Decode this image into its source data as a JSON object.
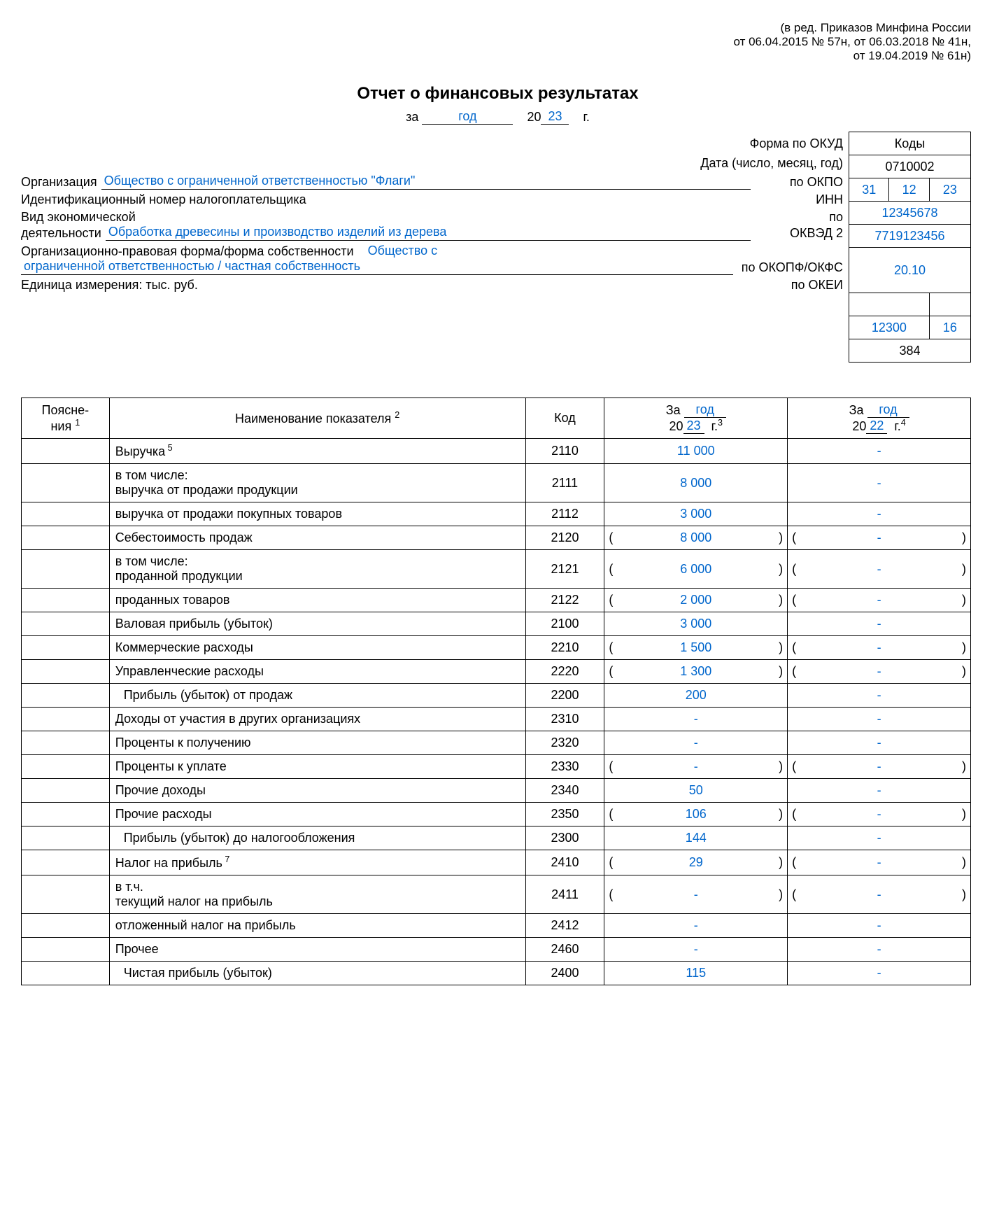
{
  "header_note": {
    "l1": "(в ред. Приказов Минфина России",
    "l2": "от 06.04.2015 № 57н, от 06.03.2018 № 41н,",
    "l3": "от 19.04.2019 № 61н)"
  },
  "title": "Отчет о финансовых результатах",
  "period": {
    "za": "за",
    "period_word": "год",
    "cent": "20",
    "yy": "23",
    "g": "г."
  },
  "codes_box": {
    "header": "Коды",
    "okud_label": "Форма по ОКУД",
    "okud": "0710002",
    "date_label": "Дата (число, месяц, год)",
    "date_d": "31",
    "date_m": "12",
    "date_y": "23",
    "okpo_label": "по ОКПО",
    "okpo": "12345678",
    "inn_label": "ИНН",
    "inn": "7719123456",
    "okved_label_top": "по",
    "okved_label": "ОКВЭД 2",
    "okved": "20.10",
    "okopf_label": "по ОКОПФ/ОКФС",
    "okopf": "12300",
    "okfs": "16",
    "okei_label": "по ОКЕИ",
    "okei": "384"
  },
  "org": {
    "label": "Организация",
    "value": "Общество с ограниченной ответственностью \"Флаги\"",
    "inn_label": "Идентификационный номер налогоплательщика",
    "activity_label1": "Вид экономической",
    "activity_label2": "деятельности",
    "activity": "Обработка древесины и производство изделий из дерева",
    "form_label": "Организационно-правовая форма/форма собственности",
    "form_value1": "Общество с",
    "form_value2": "ограниченной ответственностью / частная собственность",
    "unit_label": "Единица измерения: тыс. руб."
  },
  "table": {
    "headers": {
      "exp": "Поясне-\nния",
      "name": "Наименование показателя",
      "code": "Код",
      "za": "За",
      "period_word": "год",
      "cent": "20",
      "y1": "23",
      "y2": "22",
      "g": "г."
    },
    "rows": [
      {
        "name": "Выручка",
        "sup": "5",
        "code": "2110",
        "v1": "11 000",
        "v2": "-",
        "paren": false,
        "indent": 0
      },
      {
        "name": "в том числе:\nвыручка от продажи продукции",
        "code": "2111",
        "v1": "8 000",
        "v2": "-",
        "paren": false,
        "indent": 0,
        "two": true
      },
      {
        "name": "выручка от продажи покупных  товаров",
        "code": "2112",
        "v1": "3 000",
        "v2": "-",
        "paren": false,
        "indent": 0
      },
      {
        "name": "Себестоимость продаж",
        "code": "2120",
        "v1": "8 000",
        "v2": "-",
        "paren": true,
        "indent": 0
      },
      {
        "name": "в том числе:\nпроданной продукции",
        "code": "2121",
        "v1": "6 000",
        "v2": "-",
        "paren": true,
        "indent": 0,
        "two": true
      },
      {
        "name": "проданных товаров",
        "code": "2122",
        "v1": "2 000",
        "v2": "-",
        "paren": true,
        "indent": 0
      },
      {
        "name": "Валовая прибыль (убыток)",
        "code": "2100",
        "v1": "3 000",
        "v2": "-",
        "paren": false,
        "indent": 0
      },
      {
        "name": "Коммерческие расходы",
        "code": "2210",
        "v1": "1 500",
        "v2": "-",
        "paren": true,
        "indent": 0
      },
      {
        "name": "Управленческие расходы",
        "code": "2220",
        "v1": "1 300",
        "v2": "-",
        "paren": true,
        "indent": 0
      },
      {
        "name": "Прибыль (убыток) от продаж",
        "code": "2200",
        "v1": "200",
        "v2": "-",
        "paren": false,
        "indent": 1
      },
      {
        "name": "Доходы от участия в других организациях",
        "code": "2310",
        "v1": "-",
        "v2": "-",
        "paren": false,
        "indent": 0
      },
      {
        "name": "Проценты к получению",
        "code": "2320",
        "v1": "-",
        "v2": "-",
        "paren": false,
        "indent": 0
      },
      {
        "name": "Проценты к уплате",
        "code": "2330",
        "v1": "-",
        "v2": "-",
        "paren": true,
        "indent": 0
      },
      {
        "name": "Прочие доходы",
        "code": "2340",
        "v1": "50",
        "v2": "-",
        "paren": false,
        "indent": 0
      },
      {
        "name": "Прочие расходы",
        "code": "2350",
        "v1": "106",
        "v2": "-",
        "paren": true,
        "indent": 0
      },
      {
        "name": "Прибыль (убыток) до налогообложения",
        "code": "2300",
        "v1": "144",
        "v2": "-",
        "paren": false,
        "indent": 1
      },
      {
        "name": "Налог на прибыль",
        "sup": "7",
        "code": "2410",
        "v1": "29",
        "v2": "-",
        "paren": true,
        "indent": 0
      },
      {
        "name": "в т.ч.\nтекущий налог на прибыль",
        "code": "2411",
        "v1": "-",
        "v2": "-",
        "paren": true,
        "indent": 0,
        "two": true
      },
      {
        "name": "отложенный налог на прибыль",
        "code": "2412",
        "v1": "-",
        "v2": "-",
        "paren": false,
        "indent": 0
      },
      {
        "name": "Прочее",
        "code": "2460",
        "v1": "-",
        "v2": "-",
        "paren": false,
        "indent": 0
      },
      {
        "name": "Чистая прибыль (убыток)",
        "code": "2400",
        "v1": "115",
        "v2": "-",
        "paren": false,
        "indent": 1
      }
    ]
  }
}
